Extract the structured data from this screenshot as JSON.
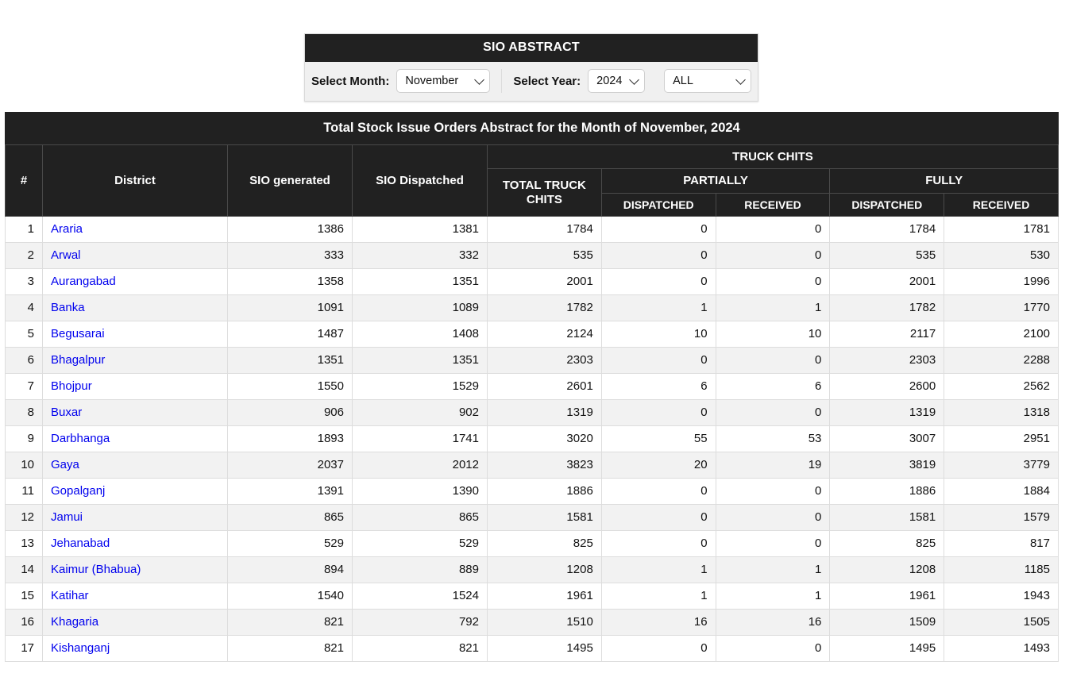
{
  "filter_panel": {
    "title": "SIO ABSTRACT",
    "month_label": "Select Month:",
    "month_value": "November",
    "year_label": "Select Year:",
    "year_value": "2024",
    "scope_value": "ALL"
  },
  "table": {
    "caption": "Total Stock Issue Orders Abstract for the Month of November, 2024",
    "headers": {
      "num": "#",
      "district": "District",
      "sio_generated": "SIO generated",
      "sio_dispatched": "SIO Dispatched",
      "truck_chits": "TRUCK CHITS",
      "total_truck_chits": "TOTAL TRUCK CHITS",
      "partially": "PARTIALLY",
      "fully": "FULLY",
      "partially_dispatched": "DISPATCHED",
      "partially_received": "RECEIVED",
      "fully_dispatched": "DISPATCHED",
      "fully_received": "RECEIVED"
    },
    "rows": [
      {
        "idx": "1",
        "district": "Araria",
        "sio_generated": "1386",
        "sio_dispatched": "1381",
        "total_truck_chits": "1784",
        "partially_dispatched": "0",
        "partially_received": "0",
        "fully_dispatched": "1784",
        "fully_received": "1781"
      },
      {
        "idx": "2",
        "district": "Arwal",
        "sio_generated": "333",
        "sio_dispatched": "332",
        "total_truck_chits": "535",
        "partially_dispatched": "0",
        "partially_received": "0",
        "fully_dispatched": "535",
        "fully_received": "530"
      },
      {
        "idx": "3",
        "district": "Aurangabad",
        "sio_generated": "1358",
        "sio_dispatched": "1351",
        "total_truck_chits": "2001",
        "partially_dispatched": "0",
        "partially_received": "0",
        "fully_dispatched": "2001",
        "fully_received": "1996"
      },
      {
        "idx": "4",
        "district": "Banka",
        "sio_generated": "1091",
        "sio_dispatched": "1089",
        "total_truck_chits": "1782",
        "partially_dispatched": "1",
        "partially_received": "1",
        "fully_dispatched": "1782",
        "fully_received": "1770"
      },
      {
        "idx": "5",
        "district": "Begusarai",
        "sio_generated": "1487",
        "sio_dispatched": "1408",
        "total_truck_chits": "2124",
        "partially_dispatched": "10",
        "partially_received": "10",
        "fully_dispatched": "2117",
        "fully_received": "2100"
      },
      {
        "idx": "6",
        "district": "Bhagalpur",
        "sio_generated": "1351",
        "sio_dispatched": "1351",
        "total_truck_chits": "2303",
        "partially_dispatched": "0",
        "partially_received": "0",
        "fully_dispatched": "2303",
        "fully_received": "2288"
      },
      {
        "idx": "7",
        "district": "Bhojpur",
        "sio_generated": "1550",
        "sio_dispatched": "1529",
        "total_truck_chits": "2601",
        "partially_dispatched": "6",
        "partially_received": "6",
        "fully_dispatched": "2600",
        "fully_received": "2562"
      },
      {
        "idx": "8",
        "district": "Buxar",
        "sio_generated": "906",
        "sio_dispatched": "902",
        "total_truck_chits": "1319",
        "partially_dispatched": "0",
        "partially_received": "0",
        "fully_dispatched": "1319",
        "fully_received": "1318"
      },
      {
        "idx": "9",
        "district": "Darbhanga",
        "sio_generated": "1893",
        "sio_dispatched": "1741",
        "total_truck_chits": "3020",
        "partially_dispatched": "55",
        "partially_received": "53",
        "fully_dispatched": "3007",
        "fully_received": "2951"
      },
      {
        "idx": "10",
        "district": "Gaya",
        "sio_generated": "2037",
        "sio_dispatched": "2012",
        "total_truck_chits": "3823",
        "partially_dispatched": "20",
        "partially_received": "19",
        "fully_dispatched": "3819",
        "fully_received": "3779"
      },
      {
        "idx": "11",
        "district": "Gopalganj",
        "sio_generated": "1391",
        "sio_dispatched": "1390",
        "total_truck_chits": "1886",
        "partially_dispatched": "0",
        "partially_received": "0",
        "fully_dispatched": "1886",
        "fully_received": "1884"
      },
      {
        "idx": "12",
        "district": "Jamui",
        "sio_generated": "865",
        "sio_dispatched": "865",
        "total_truck_chits": "1581",
        "partially_dispatched": "0",
        "partially_received": "0",
        "fully_dispatched": "1581",
        "fully_received": "1579"
      },
      {
        "idx": "13",
        "district": "Jehanabad",
        "sio_generated": "529",
        "sio_dispatched": "529",
        "total_truck_chits": "825",
        "partially_dispatched": "0",
        "partially_received": "0",
        "fully_dispatched": "825",
        "fully_received": "817"
      },
      {
        "idx": "14",
        "district": "Kaimur (Bhabua)",
        "sio_generated": "894",
        "sio_dispatched": "889",
        "total_truck_chits": "1208",
        "partially_dispatched": "1",
        "partially_received": "1",
        "fully_dispatched": "1208",
        "fully_received": "1185"
      },
      {
        "idx": "15",
        "district": "Katihar",
        "sio_generated": "1540",
        "sio_dispatched": "1524",
        "total_truck_chits": "1961",
        "partially_dispatched": "1",
        "partially_received": "1",
        "fully_dispatched": "1961",
        "fully_received": "1943"
      },
      {
        "idx": "16",
        "district": "Khagaria",
        "sio_generated": "821",
        "sio_dispatched": "792",
        "total_truck_chits": "1510",
        "partially_dispatched": "16",
        "partially_received": "16",
        "fully_dispatched": "1509",
        "fully_received": "1505"
      },
      {
        "idx": "17",
        "district": "Kishanganj",
        "sio_generated": "821",
        "sio_dispatched": "821",
        "total_truck_chits": "1495",
        "partially_dispatched": "0",
        "partially_received": "0",
        "fully_dispatched": "1495",
        "fully_received": "1493"
      }
    ]
  },
  "colors": {
    "header_dark": "#212121",
    "link_blue": "#0000ee",
    "row_alt": "#f2f2f2",
    "panel_body": "#f0f0f0",
    "border": "#dddddd"
  }
}
